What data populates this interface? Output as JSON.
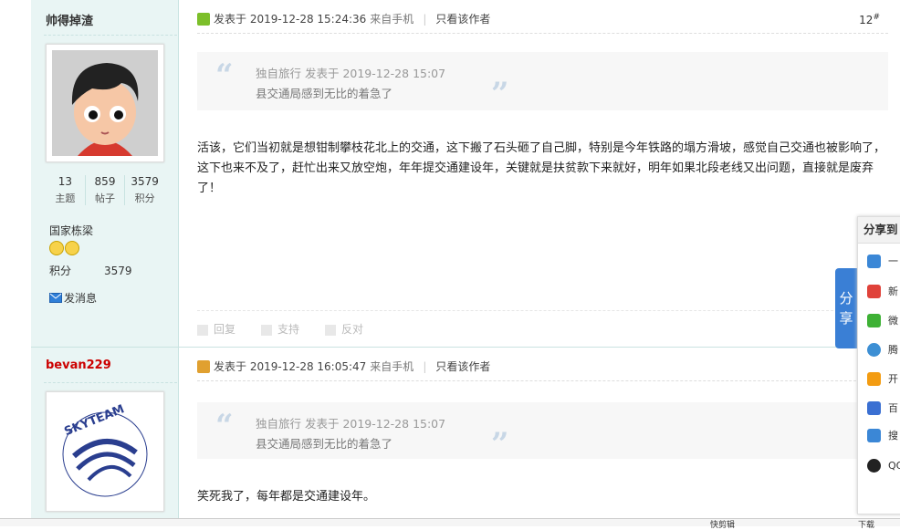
{
  "posts": [
    {
      "username": "帅得掉渣",
      "stats": [
        {
          "value": "13",
          "label": "主题"
        },
        {
          "value": "859",
          "label": "帖子"
        },
        {
          "value": "3579",
          "label": "积分"
        }
      ],
      "rank": "国家栋梁",
      "score_label": "积分",
      "score_value": "3579",
      "message_label": "发消息",
      "posted_label": "发表于",
      "posted_time": "2019-12-28 15:24:36",
      "source": "来自手机",
      "only_author": "只看该作者",
      "floor": "12",
      "floor_mark": "#",
      "quote_meta": "独自旅行 发表于 2019-12-28 15:07",
      "quote_text": "县交通局感到无比的着急了",
      "body": "活该，它们当初就是想钳制攀枝花北上的交通，这下搬了石头砸了自己脚，特别是今年铁路的塌方滑坡，感觉自己交通也被影响了，这下也来不及了，赶忙出来又放空炮，年年提交通建设年，关键就是扶贫款下来就好，明年如果北段老线又出问题，直接就是废弃了！",
      "actions": [
        "回复",
        "支持",
        "反对"
      ]
    },
    {
      "username": "bevan229",
      "avatar_text": "SKYTEAM",
      "posted_label": "发表于",
      "posted_time": "2019-12-28 16:05:47",
      "source": "来自手机",
      "only_author": "只看该作者",
      "quote_meta": "独自旅行 发表于 2019-12-28 15:07",
      "quote_text": "县交通局感到无比的着急了",
      "body": "笑死我了，每年都是交通建设年。"
    }
  ],
  "share": {
    "tab_label_1": "分",
    "tab_label_2": "享",
    "title": "分享到",
    "items": [
      {
        "label": "一",
        "color": "#3b87d6"
      },
      {
        "label": "新",
        "color": "#e0423a"
      },
      {
        "label": "微",
        "color": "#3eb135"
      },
      {
        "label": "腾",
        "color": "#3d8fd4"
      },
      {
        "label": "开",
        "color": "#f39c12"
      },
      {
        "label": "百",
        "color": "#3a6fd2"
      },
      {
        "label": "搜",
        "color": "#3b87d6"
      },
      {
        "label": "QQ",
        "color": "#222222"
      }
    ]
  },
  "statusbar": {
    "left": "快剪辑",
    "right": "下载"
  }
}
